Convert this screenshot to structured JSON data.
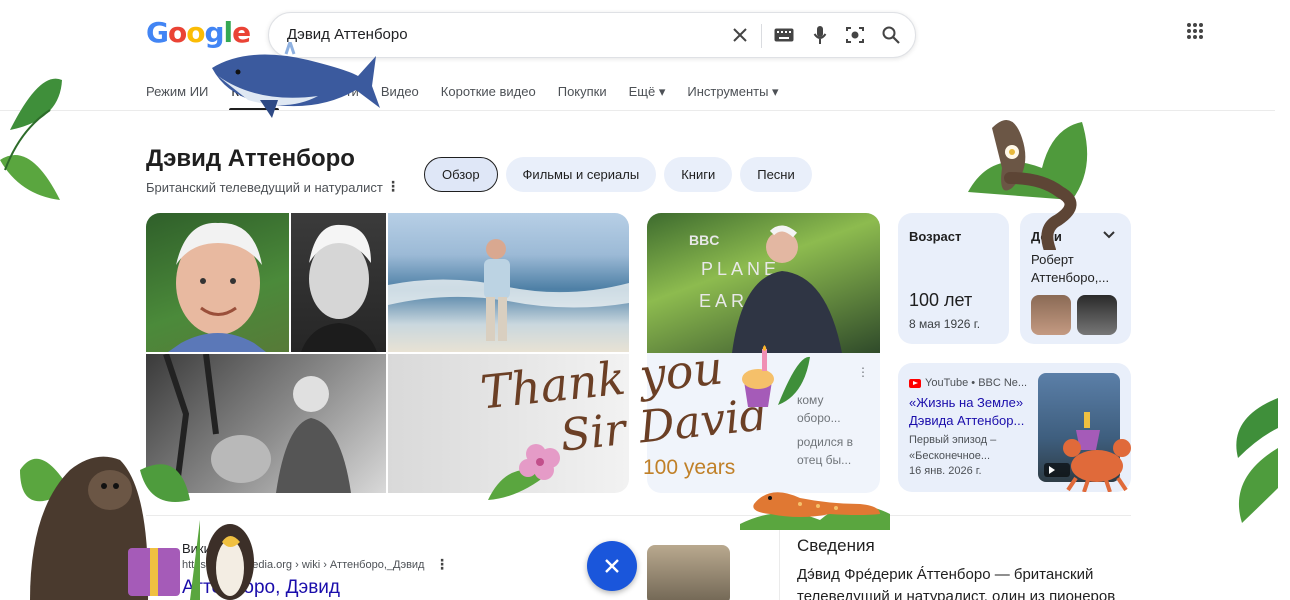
{
  "search": {
    "query": "Дэвид Аттенборо"
  },
  "logo_text": "Google",
  "tabs": [
    {
      "label": "Режим ИИ",
      "active": false
    },
    {
      "label": "Картинки",
      "active": true
    },
    {
      "label": "Новости",
      "active": false
    },
    {
      "label": "Видео",
      "active": false
    },
    {
      "label": "Короткие видео",
      "active": false
    },
    {
      "label": "Покупки",
      "active": false
    },
    {
      "label": "Ещё ▾",
      "active": false
    },
    {
      "label": "Инструменты ▾",
      "active": false
    }
  ],
  "entity": {
    "title": "Дэвид Аттенборо",
    "subtitle": "Британский телеведущий и натуралист",
    "chips": [
      {
        "label": "Обзор",
        "active": true
      },
      {
        "label": "Фильмы и сериалы",
        "active": false
      },
      {
        "label": "Книги",
        "active": false
      },
      {
        "label": "Песни",
        "active": false
      }
    ]
  },
  "story_card": {
    "lines": [
      "кому",
      "оборо...",
      "родился в",
      "отец бы..."
    ]
  },
  "age_card": {
    "label": "Возраст",
    "value": "100 лет",
    "date": "8 мая 1926 г."
  },
  "kids_card": {
    "label": "Дети",
    "name": "Роберт Аттенборо,..."
  },
  "video_card": {
    "source": "YouTube • BBC Ne...",
    "title": "«Жизнь на Земле» Дэвида Аттенбор...",
    "desc": "Первый эпизод – «Бесконечное...",
    "date": "16 янв. 2026 г."
  },
  "wiki": {
    "name": "Википедия",
    "url": "https://ru.wikipedia.org › wiki › Аттенборо,_Дэвид",
    "title": "Аттенборо, Дэвид"
  },
  "about": {
    "title": "Сведения",
    "text": "Дэ́вид Фре́дерик А́ттенборо — британский телеведущий и натуралист, один из пионеров"
  },
  "doodle": {
    "line1": "Thank you",
    "line2": "Sir David",
    "years": "100 years"
  },
  "colors": {
    "link": "#1a0dab",
    "card_bg": "#e9effa",
    "fab": "#1a56db",
    "doodle_text": "#6b3f25",
    "doodle_years": "#c08028"
  }
}
